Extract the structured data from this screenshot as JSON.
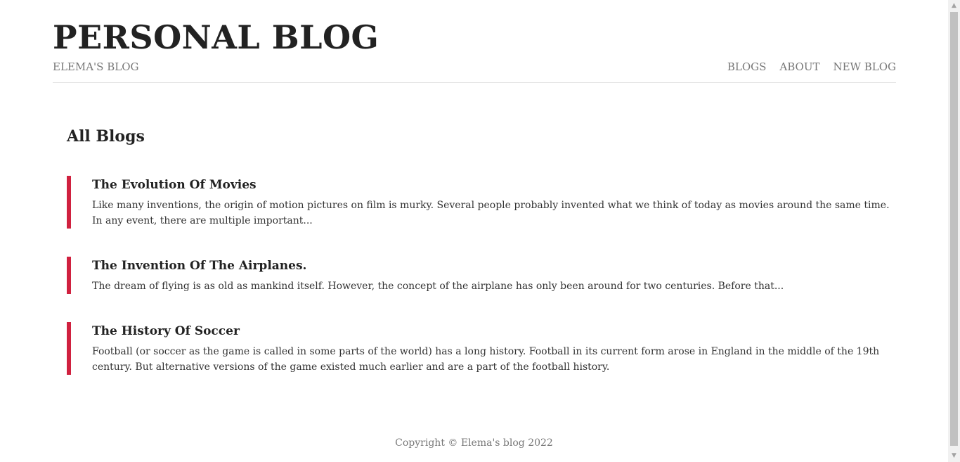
{
  "header": {
    "title": "PERSONAL BLOG",
    "subtitle": "ELEMA'S BLOG",
    "nav": [
      {
        "label": "BLOGS"
      },
      {
        "label": "ABOUT"
      },
      {
        "label": "NEW BLOG"
      }
    ]
  },
  "main": {
    "heading": "All Blogs",
    "blogs": [
      {
        "title": "The Evolution Of Movies",
        "excerpt": "Like many inventions, the origin of motion pictures on film is murky. Several people probably invented what we think of today as movies around the same time. In any event, there are multiple important..."
      },
      {
        "title": "The Invention Of The Airplanes.",
        "excerpt": "The dream of flying is as old as mankind itself. However, the concept of the airplane has only been around for two centuries. Before that..."
      },
      {
        "title": "The History Of Soccer",
        "excerpt": "Football (or soccer as the game is called in some parts of the world) has a long history. Football in its current form arose in England in the middle of the 19th century. But alternative versions of the game existed much earlier and are a part of the football history."
      }
    ]
  },
  "footer": {
    "copyright": "Copyright © Elema's blog 2022"
  },
  "colors": {
    "accent": "#d0213f",
    "muted_text": "#777777",
    "heading_text": "#222222"
  },
  "icons": {
    "scroll_up": "▲",
    "scroll_down": "▼"
  }
}
